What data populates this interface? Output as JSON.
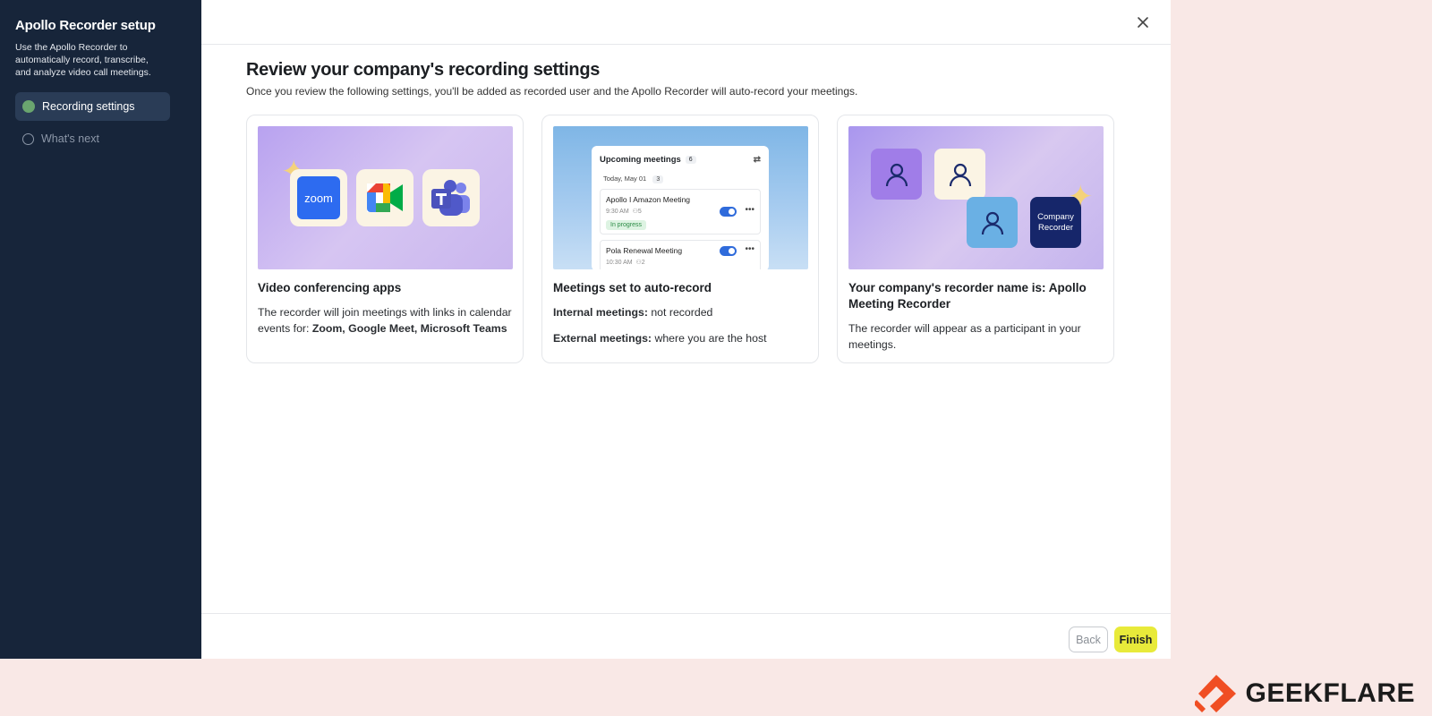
{
  "sidebar": {
    "title": "Apollo Recorder setup",
    "description": "Use the Apollo Recorder to automatically record, transcribe, and analyze video call meetings.",
    "steps": [
      {
        "label": "Recording settings",
        "state": "active"
      },
      {
        "label": "What's next",
        "state": "pending"
      }
    ]
  },
  "main": {
    "title": "Review your company's recording settings",
    "subtitle": "Once you review the following settings, you'll be added as recorded user and the Apollo Recorder will auto-record your meetings.",
    "cards": [
      {
        "title": "Video conferencing apps",
        "body_prefix": "The recorder will join meetings with links in calendar events for: ",
        "body_bold": "Zoom, Google Meet, Microsoft Teams",
        "art": {
          "zoom_label": "zoom"
        }
      },
      {
        "title": "Meetings set to auto-record",
        "line1_label": "Internal meetings:",
        "line1_value": " not recorded",
        "line2_label": "External meetings:",
        "line2_value": " where you are the host",
        "art": {
          "panel_title": "Upcoming meetings",
          "panel_count": "6",
          "day_label": "Today, May 01",
          "day_count": "3",
          "meetings": [
            {
              "name": "Apollo I Amazon Meeting",
              "time": "9:30 AM",
              "people": "5",
              "status": "In progress"
            },
            {
              "name": "Pola Renewal Meeting",
              "time": "10:30 AM",
              "people": "2"
            }
          ]
        }
      },
      {
        "title": "Your company's recorder name is: Apollo Meeting Recorder",
        "body": "The recorder will appear as a participant in your meetings.",
        "art": {
          "company_label_1": "Company",
          "company_label_2": "Recorder"
        }
      }
    ]
  },
  "footer": {
    "back_label": "Back",
    "finish_label": "Finish"
  },
  "brand": {
    "name": "GEEKFLARE"
  },
  "colors": {
    "sidebar": "#17253a",
    "finish": "#e8ea3a",
    "step_done": "#6aa56f",
    "brand_orange": "#f04e23"
  }
}
